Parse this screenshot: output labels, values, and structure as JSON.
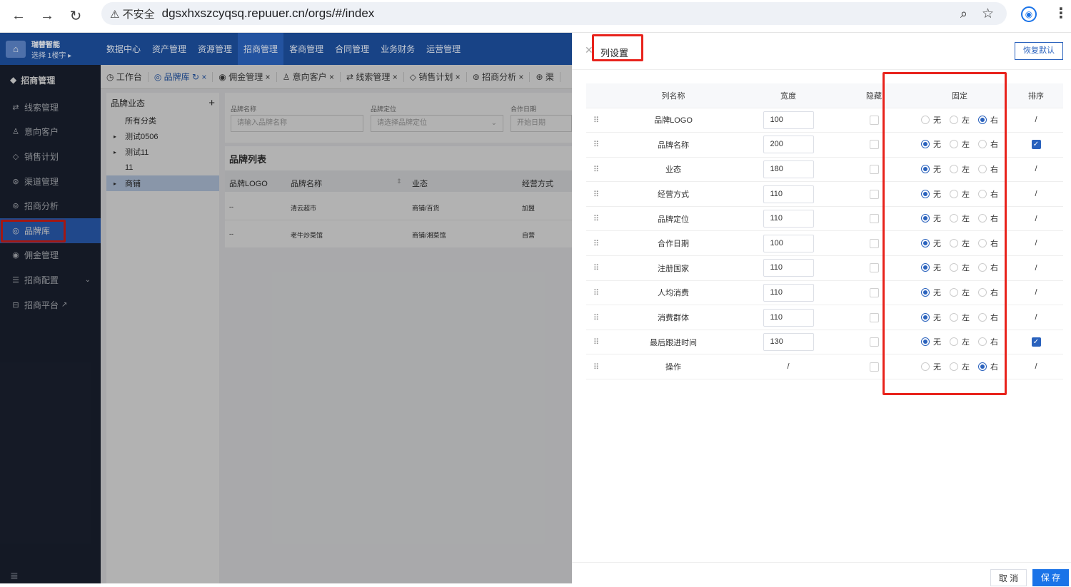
{
  "browser": {
    "security_label": "不安全",
    "url": "dgsxhxszcyqsq.repuuer.cn/orgs/#/index"
  },
  "sidebar": {
    "brand_name": "瑞替智能",
    "brand_sub": "选择 1楼宇 ▸",
    "section_title": "招商管理",
    "items": [
      {
        "label": "线索管理",
        "icon": "clue-icon"
      },
      {
        "label": "意向客户",
        "icon": "user-icon"
      },
      {
        "label": "销售计划",
        "icon": "plan-icon"
      },
      {
        "label": "渠道管理",
        "icon": "channel-icon"
      },
      {
        "label": "招商分析",
        "icon": "analysis-icon"
      },
      {
        "label": "品牌库",
        "icon": "brand-icon"
      },
      {
        "label": "佣金管理",
        "icon": "commission-icon"
      },
      {
        "label": "招商配置",
        "icon": "config-icon"
      },
      {
        "label": "招商平台",
        "icon": "platform-icon"
      }
    ]
  },
  "topnav": [
    "数据中心",
    "资产管理",
    "资源管理",
    "招商管理",
    "客商管理",
    "合同管理",
    "业务财务",
    "运营管理"
  ],
  "tabs": [
    "工作台",
    "品牌库",
    "佣金管理",
    "意向客户",
    "线索管理",
    "销售计划",
    "招商分析",
    "渠"
  ],
  "tree": {
    "header": "品牌业态",
    "add": "+",
    "nodes": [
      "所有分类",
      "测试0506",
      "测试11",
      "11",
      "商铺"
    ]
  },
  "filter": {
    "brand_name_label": "品牌名称",
    "brand_name_placeholder": "请输入品牌名称",
    "brand_pos_label": "品牌定位",
    "brand_pos_placeholder": "请选择品牌定位",
    "coop_date_label": "合作日期",
    "coop_date_placeholder": "开始日期"
  },
  "brand_list": {
    "title": "品牌列表",
    "columns": [
      "品牌LOGO",
      "品牌名称",
      "业态",
      "经营方式"
    ],
    "rows": [
      [
        "--",
        "清云超市",
        "商铺/百货",
        "加盟"
      ],
      [
        "--",
        "老牛炒菜馆",
        "商铺/湘菜馆",
        "自营"
      ]
    ]
  },
  "drawer": {
    "title": "列设置",
    "restore": "恢复默认",
    "headers": [
      "列名称",
      "宽度",
      "隐藏",
      "固定",
      "排序"
    ],
    "options": [
      "无",
      "左",
      "右"
    ],
    "rows": [
      {
        "name": "品牌LOGO",
        "width": "100",
        "fixed": "右",
        "sort": "/"
      },
      {
        "name": "品牌名称",
        "width": "200",
        "fixed": "无",
        "sort": "check"
      },
      {
        "name": "业态",
        "width": "180",
        "fixed": "无",
        "sort": "/"
      },
      {
        "name": "经营方式",
        "width": "110",
        "fixed": "无",
        "sort": "/"
      },
      {
        "name": "品牌定位",
        "width": "110",
        "fixed": "无",
        "sort": "/"
      },
      {
        "name": "合作日期",
        "width": "100",
        "fixed": "无",
        "sort": "/"
      },
      {
        "name": "注册国家",
        "width": "110",
        "fixed": "无",
        "sort": "/"
      },
      {
        "name": "人均消费",
        "width": "110",
        "fixed": "无",
        "sort": "/"
      },
      {
        "name": "消费群体",
        "width": "110",
        "fixed": "无",
        "sort": "/"
      },
      {
        "name": "最后跟进时间",
        "width": "130",
        "fixed": "无",
        "sort": "check"
      },
      {
        "name": "操作",
        "width": "/",
        "fixed": "右",
        "sort": "/"
      }
    ],
    "cancel": "取 消",
    "save": "保 存"
  },
  "colors": {
    "accent": "#2a62bd",
    "highlight": "#e8231c",
    "sidebar_bg": "#1e2536",
    "topnav_bg": "#1d4f9e"
  }
}
